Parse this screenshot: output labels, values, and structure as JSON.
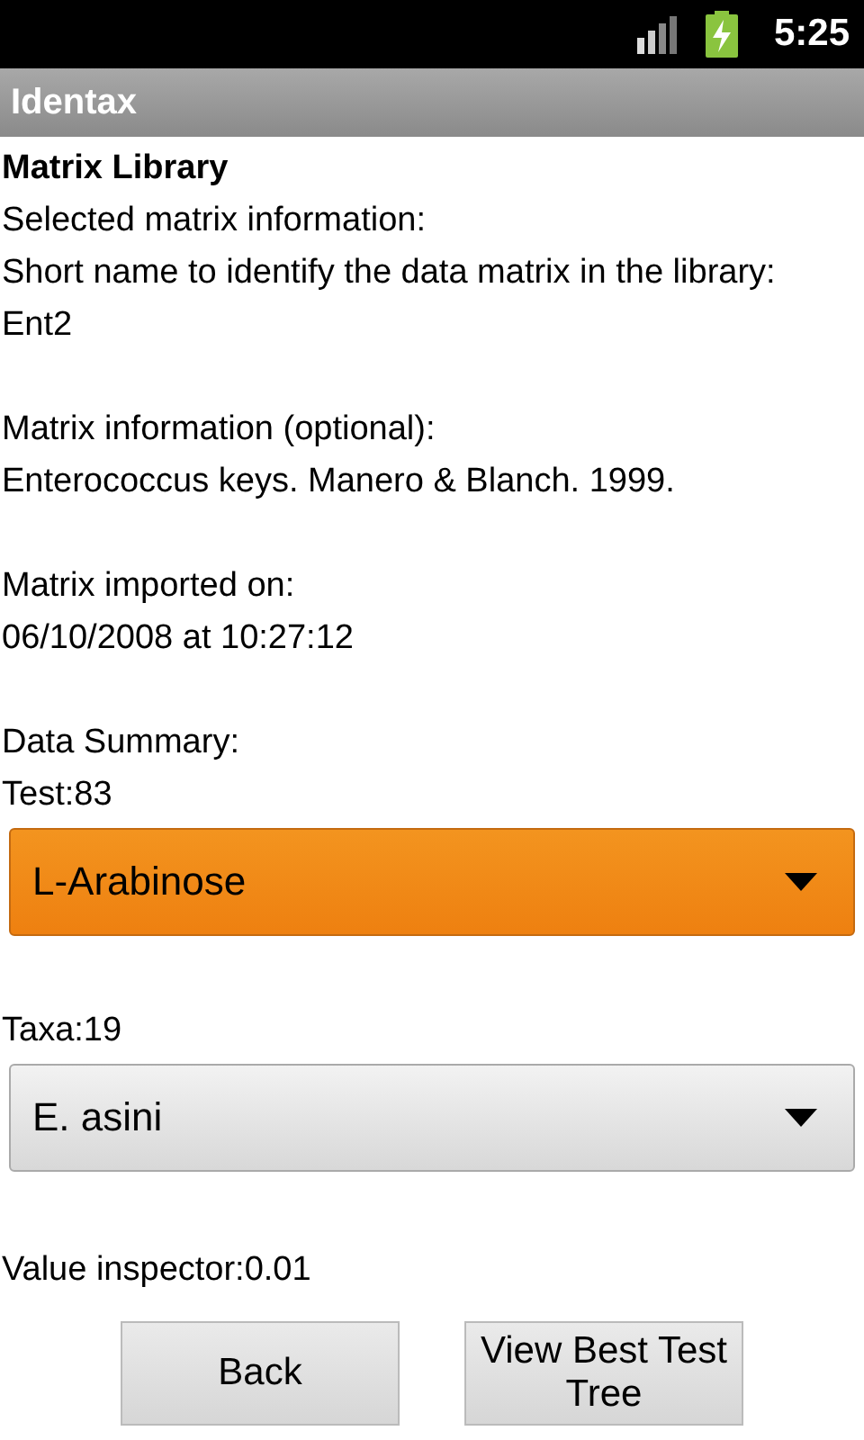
{
  "status_bar": {
    "time": "5:25"
  },
  "app_bar": {
    "title": "Identax"
  },
  "heading": "Matrix Library",
  "intro": "Selected matrix information:",
  "fields": [
    {
      "label": "Short name to identify the data matrix in the library:",
      "value": "Ent2"
    },
    {
      "label": "Matrix information (optional):",
      "value": "Enterococcus keys. Manero & Blanch. 1999."
    },
    {
      "label": "Matrix imported on:",
      "value": "06/10/2008 at 10:27:12"
    }
  ],
  "summary_label": "Data Summary:",
  "test_count": "Test:83",
  "test_spinner": {
    "value": "L-Arabinose",
    "focused": true
  },
  "taxa_count": "Taxa:19",
  "taxa_spinner": {
    "value": "E. asini",
    "focused": false
  },
  "value_inspector": "Value inspector:0.01",
  "buttons": [
    "Back",
    "View Best Test Tree"
  ]
}
